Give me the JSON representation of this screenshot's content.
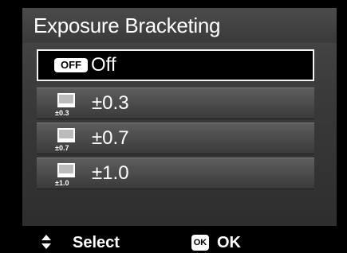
{
  "title": "Exposure Bracketing",
  "menu": {
    "items": [
      {
        "label": "Off",
        "icon_text": "OFF",
        "icon": "off-badge-icon",
        "selected": true
      },
      {
        "label": "±0.3",
        "icon_text": "±0.3",
        "icon": "bracket-0-3-icon",
        "selected": false
      },
      {
        "label": "±0.7",
        "icon_text": "±0.7",
        "icon": "bracket-0-7-icon",
        "selected": false
      },
      {
        "label": "±1.0",
        "icon_text": "±1.0",
        "icon": "bracket-1-0-icon",
        "selected": false
      }
    ]
  },
  "footer": {
    "select_label": "Select",
    "ok_badge": "OK",
    "ok_label": "OK"
  },
  "colors": {
    "highlight_border": "#f2f2f2",
    "panel": "#3a3a3a",
    "background": "#000000"
  }
}
